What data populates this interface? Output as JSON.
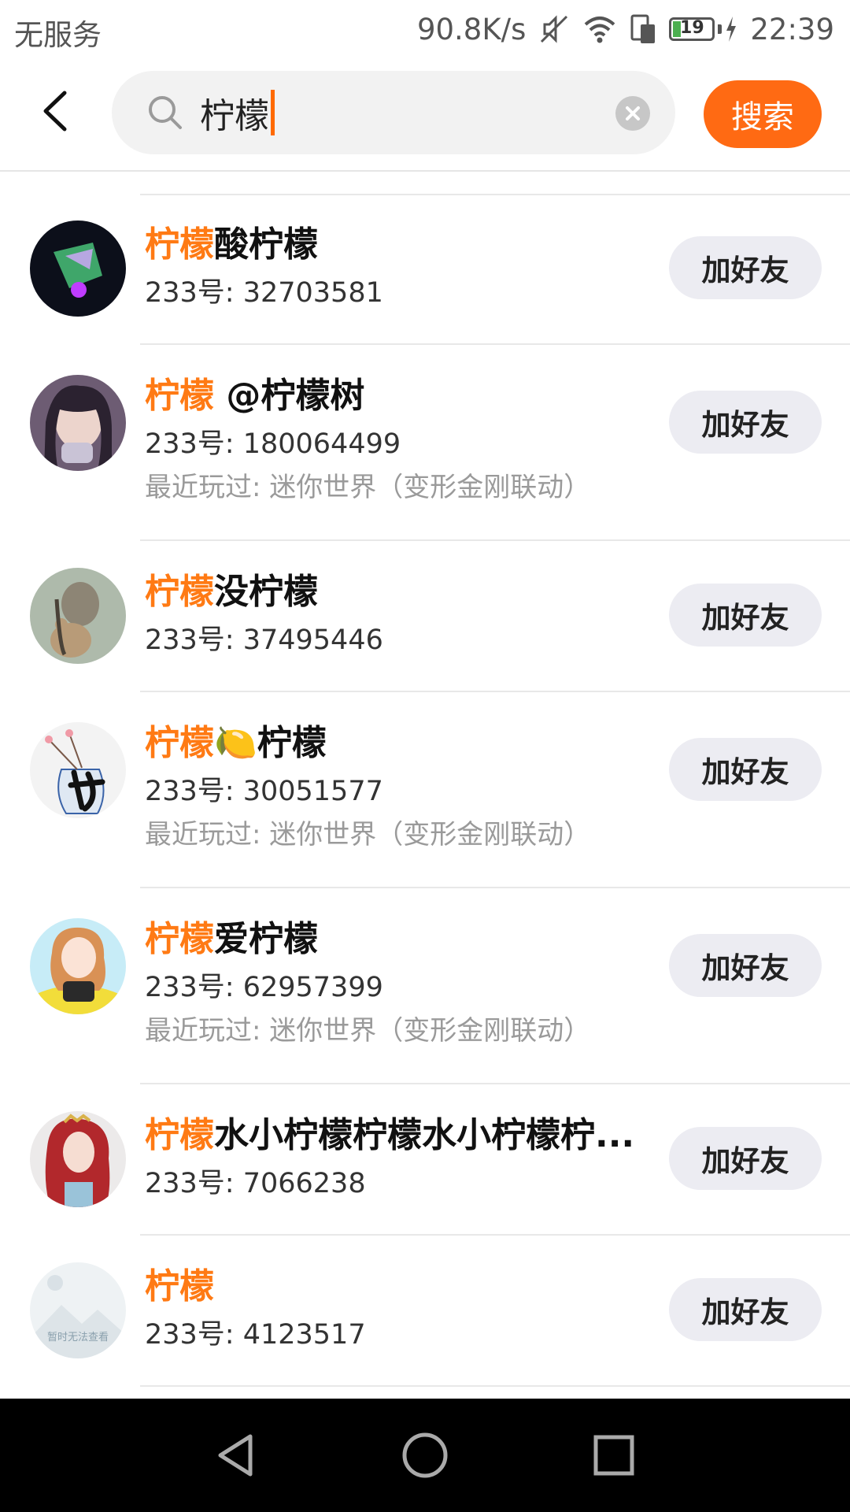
{
  "status_bar": {
    "carrier": "无服务",
    "net_speed": "90.8K/s",
    "battery": "19",
    "battery_level": 0.19,
    "time": "22:39"
  },
  "search": {
    "query": "柠檬",
    "button_label": "搜索"
  },
  "colors": {
    "accent": "#ff6a13",
    "highlight": "#ff7a14",
    "button_bg": "#ececf2"
  },
  "results": [
    {
      "highlight": "柠檬",
      "rest": "酸柠檬",
      "id": "233号: 32703581",
      "recent": "",
      "add_label": "加好友",
      "avatar_icon": "avatar-dark-glow"
    },
    {
      "highlight": "柠檬",
      "rest": " @柠檬树",
      "id": "233号: 180064499",
      "recent": "最近玩过: 迷你世界（变形金刚联动）",
      "add_label": "加好友",
      "avatar_icon": "avatar-girl-photo"
    },
    {
      "highlight": "柠檬",
      "rest": "没柠檬",
      "id": "233号: 37495446",
      "recent": "",
      "add_label": "加好友",
      "avatar_icon": "avatar-girl-teddy"
    },
    {
      "highlight": "柠檬",
      "rest": "柠檬",
      "emoji": "🍋",
      "id": "233号: 30051577",
      "recent": "最近玩过: 迷你世界（变形金刚联动）",
      "add_label": "加好友",
      "avatar_icon": "avatar-vase-calligraphy"
    },
    {
      "highlight": "柠檬",
      "rest": "爱柠檬",
      "id": "233号: 62957399",
      "recent": "最近玩过: 迷你世界（变形金刚联动）",
      "add_label": "加好友",
      "avatar_icon": "avatar-anime-girl"
    },
    {
      "highlight": "柠檬",
      "rest": "水小柠檬柠檬水小柠檬柠...",
      "id": "233号: 7066238",
      "recent": "",
      "add_label": "加好友",
      "avatar_icon": "avatar-red-hair-princess"
    },
    {
      "highlight": "柠檬",
      "rest": "",
      "id": "233号: 4123517",
      "recent": "",
      "add_label": "加好友",
      "avatar_icon": "avatar-placeholder",
      "avatar_text": "暂时无法查看"
    }
  ]
}
